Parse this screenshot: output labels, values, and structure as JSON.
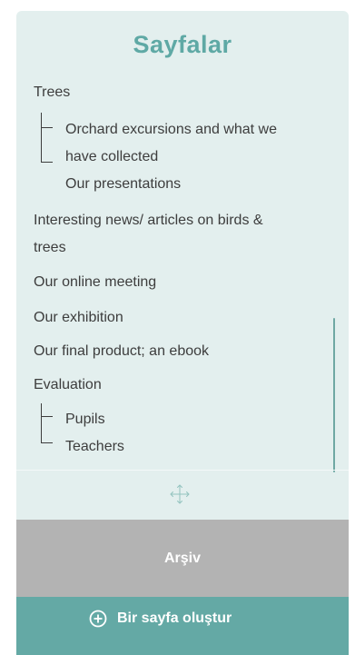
{
  "panel": {
    "title": "Sayfalar"
  },
  "pages": {
    "trees": "Trees",
    "orchard_line1": "Orchard excursions and what we",
    "orchard_line2": "have collected",
    "presentations": "Our presentations",
    "news_line1": "Interesting news/ articles on birds &",
    "news_line2": "trees",
    "online_meeting": "Our online meeting",
    "exhibition": "Our exhibition",
    "final_product": "Our final product; an ebook",
    "evaluation": "Evaluation",
    "pupils": "Pupils",
    "teachers": "Teachers"
  },
  "buttons": {
    "archive": "Arşiv",
    "create_page": "Bir sayfa oluştur"
  },
  "icons": {
    "move": "move-arrows-icon",
    "create": "plus-circle-icon"
  },
  "colors": {
    "panel_bg": "#e3efee",
    "title": "#5fa9a5",
    "archive_bg": "#b3b3b3",
    "create_bg": "#64a9a5",
    "text": "#3d3d3d"
  }
}
